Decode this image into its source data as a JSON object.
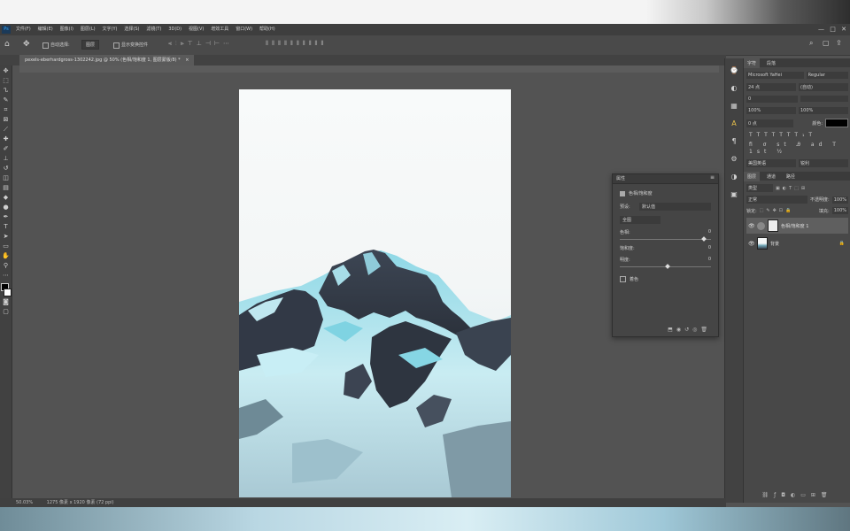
{
  "menubar": {
    "logo": "Ps",
    "items": [
      "文件(F)",
      "编辑(E)",
      "图像(I)",
      "图层(L)",
      "文字(Y)",
      "选择(S)",
      "滤镜(T)",
      "3D(D)",
      "视图(V)",
      "增效工具",
      "窗口(W)",
      "帮助(H)"
    ]
  },
  "options": {
    "home_icon": "home-icon",
    "tool_icon": "move-tool-icon",
    "auto_select_label": "自动选择:",
    "auto_select_value": "图层",
    "transform_label": "显示变换控件"
  },
  "document_tab": {
    "title": "pexels-eberhardgross-1302242.jpg @ 50% (色相/饱和度 1, 图层蒙版/8) *",
    "close": "×"
  },
  "status": {
    "zoom": "50.03%",
    "info": "1275 像素 x 1920 像素 (72 ppi)"
  },
  "panel_right": {
    "tabs": [
      "字符",
      "段落"
    ],
    "char_font": "Microsoft YaHei",
    "char_style": "Regular",
    "char_size": "24 点",
    "char_leading": "(自动)",
    "char_tracking": "0",
    "char_scale_v": "100%",
    "char_scale_h": "100%",
    "char_baseline": "0 点",
    "char_color_label": "颜色:",
    "lang_label": "美国英语",
    "aa_label": "锐利",
    "layers_tabs": [
      "图层",
      "通道",
      "路径"
    ],
    "kind_label": "类型",
    "mode_label": "正常",
    "opacity_label": "不透明度:",
    "opacity_value": "100%",
    "lock_label": "锁定:",
    "fill_label": "填充:",
    "fill_value": "100%",
    "layers": [
      {
        "name": "色相/饱和度 1",
        "active": true
      },
      {
        "name": "背景",
        "active": false
      }
    ]
  },
  "properties_dialog": {
    "title": "属性",
    "header": "色相/饱和度",
    "preset_label": "预设:",
    "preset_value": "默认值",
    "channel_value": "全图",
    "hue_label": "色相:",
    "hue_value": "0",
    "saturation_label": "饱和度:",
    "saturation_value": "0",
    "lightness_label": "明度:",
    "lightness_value": "0",
    "colorize_label": "着色",
    "hue_level": 0.9,
    "lightness_level": 0.5
  },
  "colors": {
    "sky": "#f4f7f7",
    "snow": "#cfe8ee",
    "ice": "#7fd3e2",
    "rock": "#39414d",
    "rock_dark": "#262b33"
  }
}
